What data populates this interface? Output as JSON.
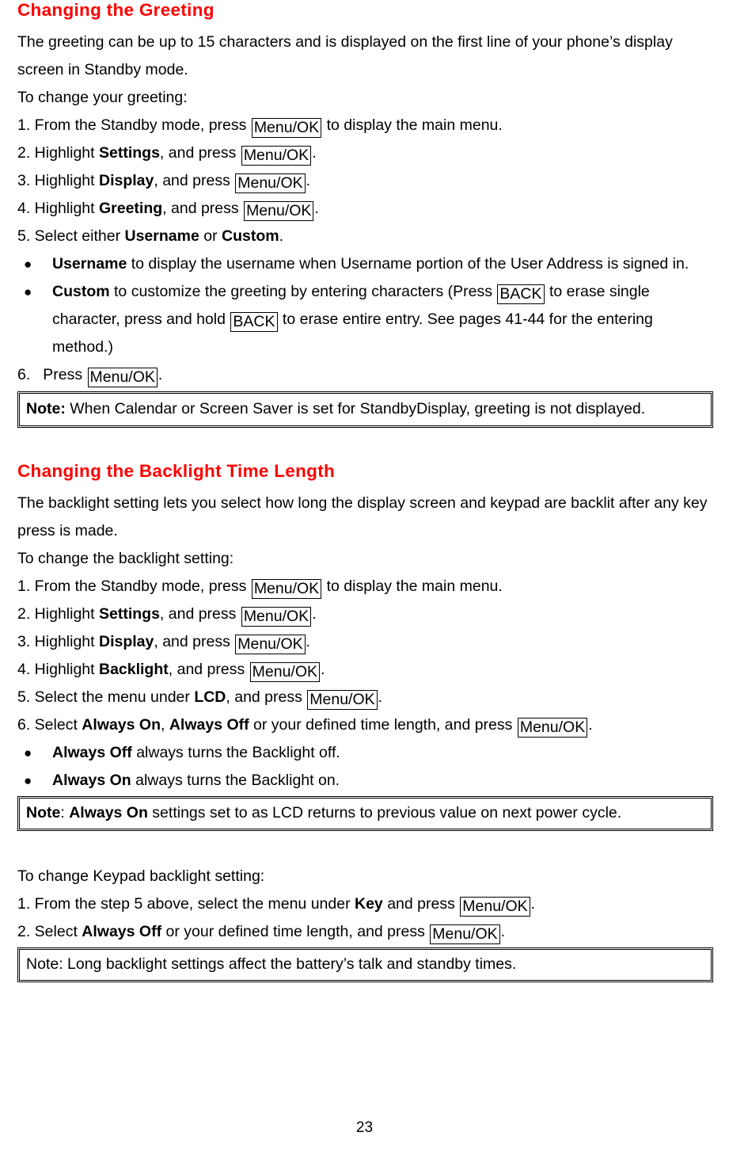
{
  "document": {
    "page_number": "23",
    "heading_color": "#ff0000",
    "text_color": "#000000"
  },
  "section1": {
    "heading": "Changing the Greeting",
    "intro": "The greeting can be up to 15 characters and is displayed on the first line of your phone’s display screen in Standby mode.",
    "lead_in": "To change your greeting:",
    "step1_a": "1. From the Standby mode, press ",
    "step1_key": "Menu/OK",
    "step1_b": " to display the main menu.",
    "step2_a": "2. Highlight ",
    "step2_bold": "Settings",
    "step2_b": ", and press ",
    "step2_key": "Menu/OK",
    "step2_c": ".",
    "step3_a": "3. Highlight ",
    "step3_bold": "Display",
    "step3_b": ", and press ",
    "step3_key": "Menu/OK",
    "step3_c": ".",
    "step4_a": "4. Highlight ",
    "step4_bold": "Greeting",
    "step4_b": ", and press ",
    "step4_key": "Menu/OK",
    "step4_c": ".",
    "step5_a": "5. Select either ",
    "step5_bold1": "Username",
    "step5_b": " or ",
    "step5_bold2": "Custom",
    "step5_c": ".",
    "bullet1_bold": "Username",
    "bullet1_text": " to display the username when Username portion of the User Address is signed in.",
    "bullet2_bold": "Custom",
    "bullet2_text_a": " to customize the greeting by entering characters (Press ",
    "bullet2_key1": "BACK",
    "bullet2_text_b": " to erase single character, press and hold ",
    "bullet2_key2": "BACK",
    "bullet2_text_c": " to erase entire entry. See pages 41-44 for the entering method.)",
    "step6_a": "6.",
    "step6_b": "Press ",
    "step6_key": "Menu/OK",
    "step6_c": ".",
    "note_label": "Note:",
    "note_text": " When Calendar or Screen Saver is set for StandbyDisplay, greeting is not displayed.",
    "bullet_glyph": "●"
  },
  "section2": {
    "heading": "Changing the Backlight Time Length",
    "intro": "The backlight setting lets you select how long the display screen and keypad are backlit after any key press is made.",
    "lead_in": "To change the backlight setting:",
    "step1_a": "1. From the Standby mode, press ",
    "step1_key": "Menu/OK",
    "step1_b": " to display the main menu.",
    "step2_a": "2. Highlight ",
    "step2_bold": "Settings",
    "step2_b": ", and press ",
    "step2_key": "Menu/OK",
    "step2_c": ".",
    "step3_a": "3. Highlight ",
    "step3_bold": "Display",
    "step3_b": ", and press ",
    "step3_key": "Menu/OK",
    "step3_c": ".",
    "step4_a": "4. Highlight ",
    "step4_bold": "Backlight",
    "step4_b": ", and press ",
    "step4_key": "Menu/OK",
    "step4_c": ".",
    "step5_a": "5. Select the menu under ",
    "step5_bold": "LCD",
    "step5_b": ", and press ",
    "step5_key": "Menu/OK",
    "step5_c": ".",
    "step6_a": "6. Select ",
    "step6_bold1": "Always On",
    "step6_b": ", ",
    "step6_bold2": "Always Off",
    "step6_c": " or your defined time length, and press ",
    "step6_key": "Menu/OK",
    "step6_d": ".",
    "bullet1_bold": "Always Off",
    "bullet1_text": " always turns the Backlight off.",
    "bullet2_bold": "Always On",
    "bullet2_text": " always turns the Backlight on.",
    "note_label": "Note",
    "note_colon": ": ",
    "note_bold": "Always On",
    "note_text": " settings set to as LCD returns to previous value on next power cycle.",
    "bullet_glyph": "●"
  },
  "section3": {
    "lead_in": "To change Keypad backlight setting:",
    "step1_a": "1. From the step 5 above, select the menu under ",
    "step1_bold": "Key",
    "step1_b": " and press ",
    "step1_key": "Menu/OK",
    "step1_c": ".",
    "step2_a": "2. Select ",
    "step2_bold": "Always Off",
    "step2_b": " or your defined time length, and press ",
    "step2_key": "Menu/OK",
    "step2_c": ".",
    "note_text": "Note: Long backlight settings affect the battery’s talk and standby times."
  }
}
